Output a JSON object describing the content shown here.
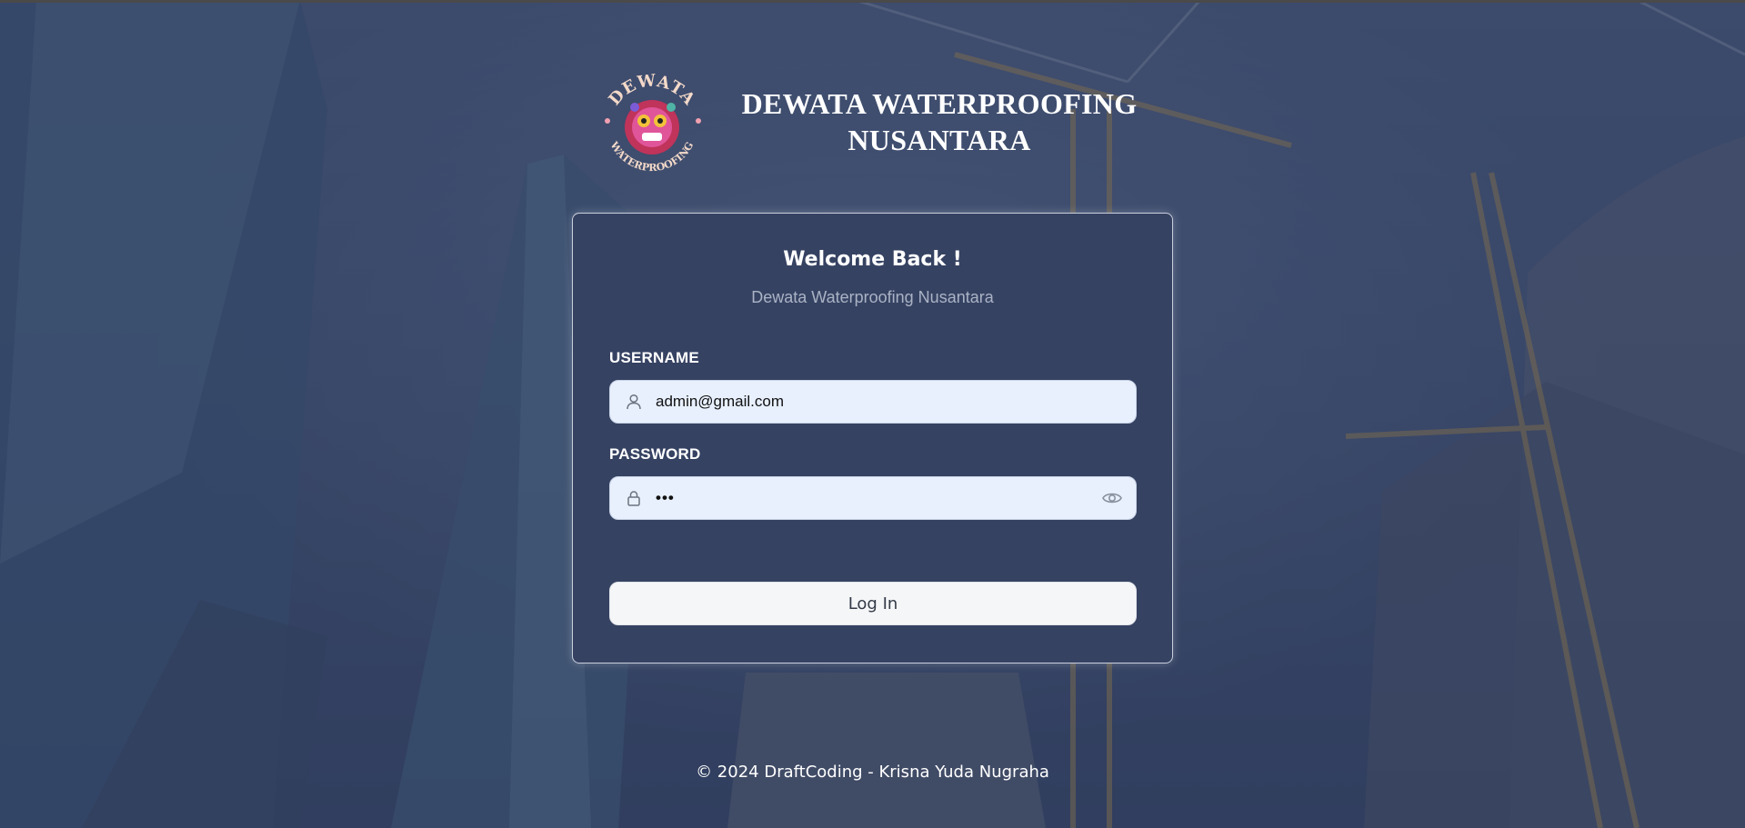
{
  "brand": {
    "logo_text_top": "DEWATA",
    "logo_text_bottom": "WATERPROOFING",
    "title_line1": "DEWATA WATERPROOFING",
    "title_line2": "NUSANTARA"
  },
  "login": {
    "title": "Welcome Back !",
    "subtitle": "Dewata Waterproofing Nusantara",
    "username_label": "USERNAME",
    "username_value": "admin@gmail.com",
    "password_label": "PASSWORD",
    "password_value": "•••",
    "submit_label": "Log In"
  },
  "footer": {
    "text": "© 2024 DraftCoding - Krisna Yuda Nugraha"
  },
  "icons": {
    "username": "user-icon",
    "password": "lock-icon",
    "toggle": "eye-icon"
  },
  "colors": {
    "card_bg": "#364262",
    "input_bg": "#e8f0fe",
    "button_bg": "#f5f6f8",
    "overlay": "#283454"
  }
}
